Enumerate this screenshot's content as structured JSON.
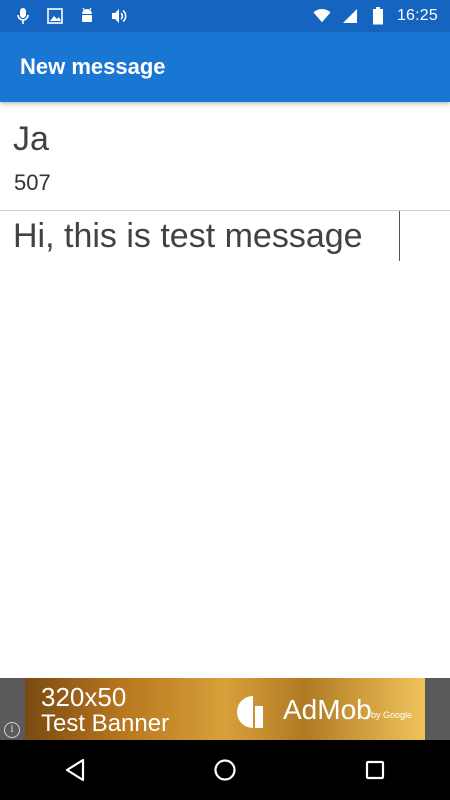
{
  "status_bar": {
    "time": "16:25",
    "left_icons": [
      "mic-icon",
      "image-icon",
      "android-icon",
      "volume-icon"
    ],
    "right_icons": [
      "wifi-icon",
      "signal-icon",
      "battery-icon"
    ]
  },
  "app_bar": {
    "title": "New message",
    "color": "#1976d2"
  },
  "recipient": {
    "name": "Ja",
    "number": "507"
  },
  "message": {
    "text": "Hi, this is test message"
  },
  "ad": {
    "size_text": "320x50",
    "label": "Test Banner",
    "brand": "AdMob",
    "by": "by Google",
    "info_icon": "info-icon"
  },
  "nav_bar": {
    "buttons": [
      "back-icon",
      "home-icon",
      "recents-icon"
    ]
  }
}
